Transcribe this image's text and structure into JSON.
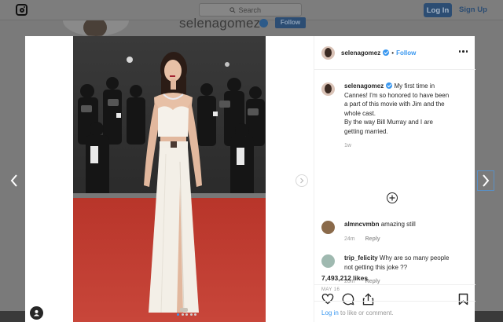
{
  "topbar": {
    "search_placeholder": "Search",
    "login_label": "Log In",
    "signup_label": "Sign Up"
  },
  "background_profile": {
    "username": "selenagomez",
    "follow_label": "Follow"
  },
  "post": {
    "username": "selenagomez",
    "separator": "•",
    "follow_label": "Follow",
    "caption_lines": [
      "My first time in",
      "Cannes! I'm so honored to have been",
      "a part of this movie with Jim and the",
      "whole cast.",
      "By the way Bill Murray and I are",
      "getting married."
    ],
    "caption_age": "1w",
    "comments": [
      {
        "username": "almncvmbn",
        "text": "amazing still",
        "age": "24m",
        "reply_label": "Reply"
      },
      {
        "username": "trip_felicity",
        "text": "Why are so many people",
        "text_line2": "not getting this joke ??",
        "age": "20m",
        "reply_label": "Reply"
      }
    ],
    "likes": "7,493,212 likes",
    "date": "MAY 16",
    "login_link": "Log in",
    "login_suffix": "to like or comment."
  },
  "carousel": {
    "total": 5,
    "active_index": 0
  },
  "icons": {
    "logo": "instagram-icon",
    "search": "search-icon",
    "verified": "verified-badge-icon",
    "more": "more-options-icon",
    "add_comment": "plus-circle-icon",
    "like": "heart-icon",
    "comment": "comment-bubble-icon",
    "share": "share-icon",
    "save": "bookmark-icon",
    "prev": "chevron-left-icon",
    "next": "chevron-right-icon",
    "tagged": "user-tag-icon"
  },
  "colors": {
    "accent": "#3897f0",
    "text": "#262626",
    "muted": "#999999",
    "carpet": "#c0392b",
    "dress": "#f3efe7"
  }
}
